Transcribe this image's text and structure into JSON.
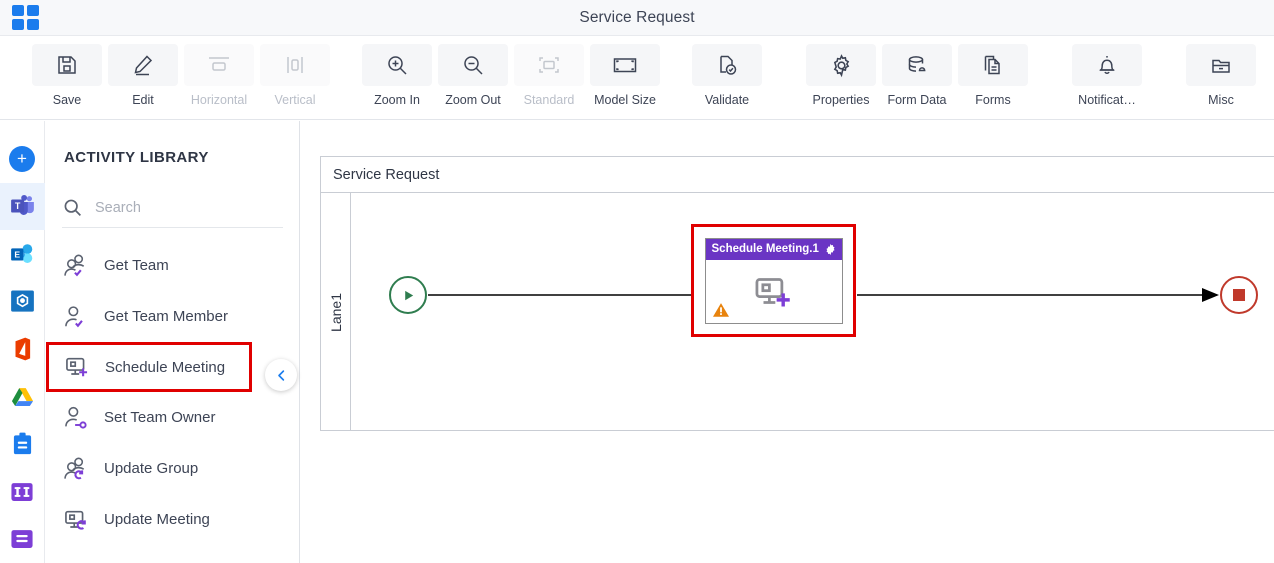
{
  "window": {
    "title": "Service Request"
  },
  "toolbar": {
    "items": [
      {
        "label": "Save",
        "icon": "save-icon",
        "disabled": false
      },
      {
        "label": "Edit",
        "icon": "edit-pencil-icon",
        "disabled": false
      },
      {
        "label": "Horizontal",
        "icon": "horizontal-align-icon",
        "disabled": true
      },
      {
        "label": "Vertical",
        "icon": "vertical-align-icon",
        "disabled": true
      },
      {
        "label": "Zoom In",
        "icon": "zoom-in-icon",
        "disabled": false
      },
      {
        "label": "Zoom Out",
        "icon": "zoom-out-icon",
        "disabled": false
      },
      {
        "label": "Standard",
        "icon": "standard-size-icon",
        "disabled": true
      },
      {
        "label": "Model Size",
        "icon": "model-size-icon",
        "disabled": false
      },
      {
        "label": "Validate",
        "icon": "validate-check-icon",
        "disabled": false
      },
      {
        "label": "Properties",
        "icon": "gear-icon",
        "disabled": false
      },
      {
        "label": "Form Data",
        "icon": "database-icon",
        "disabled": false
      },
      {
        "label": "Forms",
        "icon": "document-icon",
        "disabled": false
      },
      {
        "label": "Notificat…",
        "icon": "bell-icon",
        "disabled": false
      },
      {
        "label": "Misc",
        "icon": "folder-icon",
        "disabled": false
      }
    ]
  },
  "rail": {
    "add_label": "+",
    "items": [
      {
        "name": "add-connector-button",
        "icon": "plus-circle-icon"
      },
      {
        "name": "microsoft-teams",
        "icon": "teams-icon"
      },
      {
        "name": "microsoft-exchange",
        "icon": "exchange-icon"
      },
      {
        "name": "sharepoint",
        "icon": "sharepoint-icon"
      },
      {
        "name": "microsoft-office",
        "icon": "office-icon"
      },
      {
        "name": "google-drive",
        "icon": "google-drive-icon"
      },
      {
        "name": "planner",
        "icon": "clipboard-icon"
      },
      {
        "name": "jira",
        "icon": "columns-icon"
      },
      {
        "name": "list-app",
        "icon": "lines-icon"
      }
    ]
  },
  "panel": {
    "title": "ACTIVITY LIBRARY",
    "search": {
      "placeholder": "Search",
      "value": ""
    },
    "activities": [
      {
        "label": "Get Team",
        "icon": "two-person-check-icon",
        "selected": false
      },
      {
        "label": "Get Team Member",
        "icon": "person-check-icon",
        "selected": false
      },
      {
        "label": "Schedule Meeting",
        "icon": "screen-plus-icon",
        "selected": true
      },
      {
        "label": "Set Team Owner",
        "icon": "person-key-icon",
        "selected": false
      },
      {
        "label": "Update Group",
        "icon": "two-person-refresh-icon",
        "selected": false
      },
      {
        "label": "Update Meeting",
        "icon": "screen-refresh-icon",
        "selected": false
      }
    ],
    "collapse_icon": "chevron-left-icon"
  },
  "canvas": {
    "pool_title": "Service Request",
    "lane_label": "Lane1",
    "start_node": {
      "name": "start-event",
      "icon": "play-icon",
      "color": "#2f7d4f"
    },
    "end_node": {
      "name": "end-event",
      "icon": "stop-square-icon",
      "color": "#c0392b"
    },
    "task": {
      "title": "Schedule Meeting.1",
      "header_color": "#6a35c4",
      "settings_icon": "gear-icon",
      "body_icon": "screen-plus-icon",
      "warning_icon": "warning-triangle-icon",
      "selected": true,
      "selection_color": "#e00000"
    }
  }
}
